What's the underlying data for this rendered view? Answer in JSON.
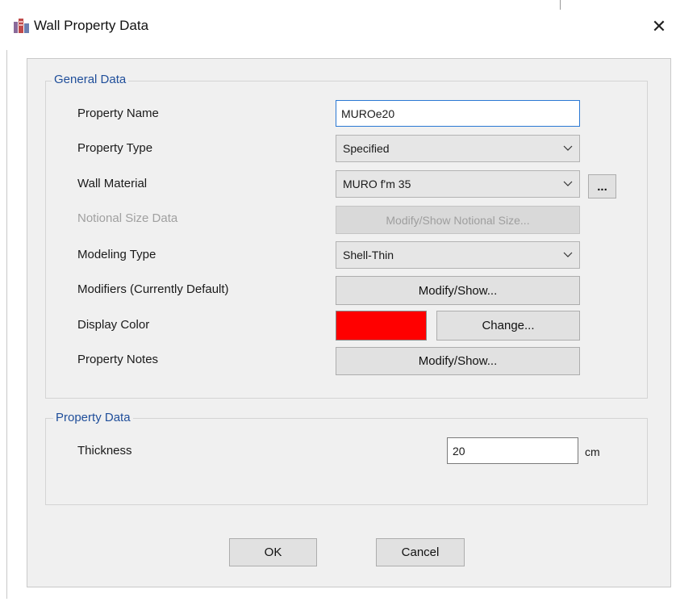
{
  "window": {
    "title": "Wall Property Data",
    "close_glyph": "✕"
  },
  "general_data": {
    "title": "General Data",
    "property_name": {
      "label": "Property Name",
      "value": "MUROe20"
    },
    "property_type": {
      "label": "Property Type",
      "value": "Specified"
    },
    "wall_material": {
      "label": "Wall Material",
      "value": "MURO f'm 35",
      "ellipsis_label": "..."
    },
    "notional_size": {
      "label": "Notional Size Data",
      "button_label": "Modify/Show Notional Size..."
    },
    "modeling_type": {
      "label": "Modeling Type",
      "value": "Shell-Thin"
    },
    "modifiers": {
      "label": "Modifiers (Currently Default)",
      "button_label": "Modify/Show..."
    },
    "display_color": {
      "label": "Display Color",
      "color": "#ff0000",
      "button_label": "Change..."
    },
    "property_notes": {
      "label": "Property Notes",
      "button_label": "Modify/Show..."
    }
  },
  "property_data": {
    "title": "Property Data",
    "thickness": {
      "label": "Thickness",
      "value": "20",
      "unit": "cm"
    }
  },
  "actions": {
    "ok_label": "OK",
    "cancel_label": "Cancel"
  },
  "icons": {
    "app": "building-icon",
    "close": "close-icon",
    "dropdown": "chevron-down-icon"
  }
}
